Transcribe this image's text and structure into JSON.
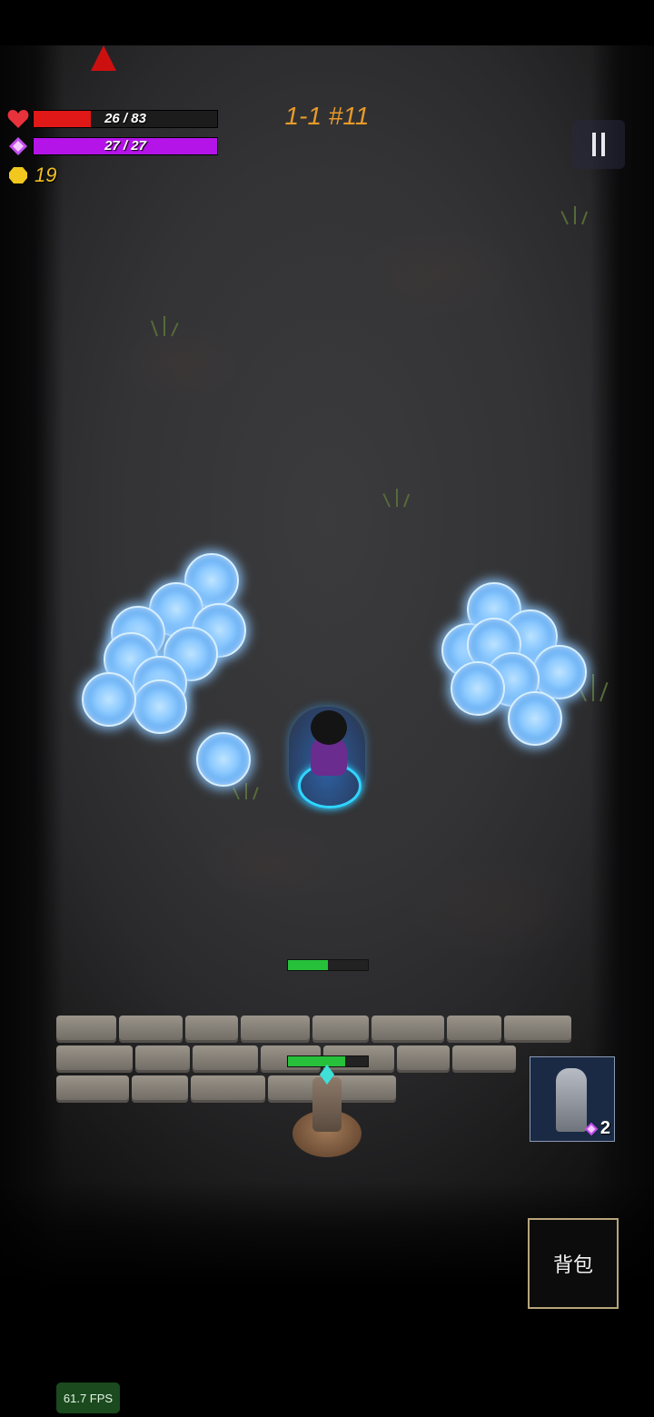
{
  "hud": {
    "health": {
      "text": "26 / 83",
      "current": 26,
      "max": 83,
      "color": "#e01818"
    },
    "mana": {
      "text": "27 / 27",
      "current": 27,
      "max": 27,
      "color": "#b414e8"
    },
    "gold": {
      "text": "19",
      "color": "#f0c020"
    },
    "stage_label": "1-1 #11",
    "icons": {
      "health": "heart-icon",
      "mana": "diamond-icon",
      "gold": "coin-icon",
      "pause": "pause-icon"
    }
  },
  "wall_health": {
    "fraction": 0.5,
    "color": "#27c03b"
  },
  "turret_health": {
    "fraction": 0.72,
    "color": "#27c03b"
  },
  "statue_card": {
    "count": "2",
    "icon": "statue-icon"
  },
  "bag_button": {
    "label": "背包"
  },
  "fps": {
    "text": "61.7 FPS"
  }
}
